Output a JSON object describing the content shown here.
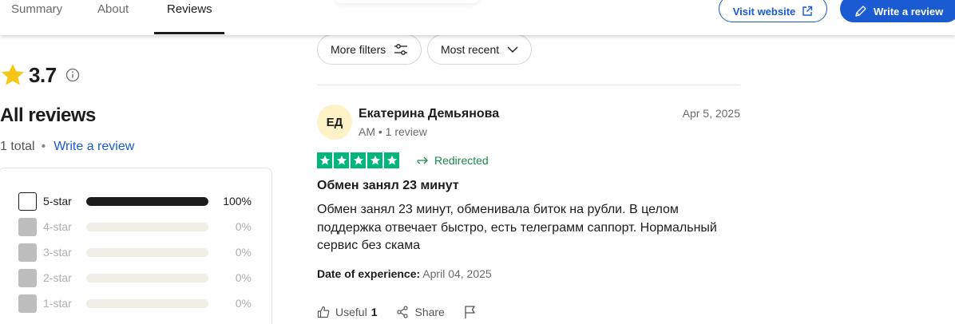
{
  "nav": {
    "tabs": [
      {
        "label": "Summary"
      },
      {
        "label": "About"
      },
      {
        "label": "Reviews",
        "active": true
      }
    ],
    "visit_website": "Visit website",
    "write_review": "Write a review"
  },
  "summary": {
    "rating": "3.7",
    "all_reviews": "All reviews",
    "total": "1 total",
    "write_link": "Write a review",
    "distribution": [
      {
        "label": "5-star",
        "percent_text": "100%",
        "fraction": 1.0,
        "enabled": true
      },
      {
        "label": "4-star",
        "percent_text": "0%",
        "fraction": 0.0,
        "enabled": false
      },
      {
        "label": "3-star",
        "percent_text": "0%",
        "fraction": 0.0,
        "enabled": false
      },
      {
        "label": "2-star",
        "percent_text": "0%",
        "fraction": 0.0,
        "enabled": false
      },
      {
        "label": "1-star",
        "percent_text": "0%",
        "fraction": 0.0,
        "enabled": false
      }
    ]
  },
  "filters": {
    "more_filters": "More filters",
    "sort": "Most recent"
  },
  "review": {
    "initials": "ЕД",
    "name": "Екатерина Демьянова",
    "meta": "AM • 1 review",
    "date": "Apr 5, 2025",
    "stars": 5,
    "redirect_label": "Redirected",
    "title": "Обмен занял 23 минут",
    "body": "Обмен занял 23 минут, обменивала биток на рубли. В целом поддержка отвечает быстро, есть телеграмм саппорт. Нормальный сервис без скама",
    "exp_label": "Date of experience:",
    "exp_value": "April 04, 2025",
    "useful_label": "Useful",
    "useful_count": "1",
    "share_label": "Share"
  },
  "colors": {
    "accent": "#1a5bd1",
    "trust_green": "#00b67a",
    "redirect_green": "#1b8a4a",
    "star_yellow": "#f5c518",
    "avatar_bg": "#fdf3c6"
  }
}
